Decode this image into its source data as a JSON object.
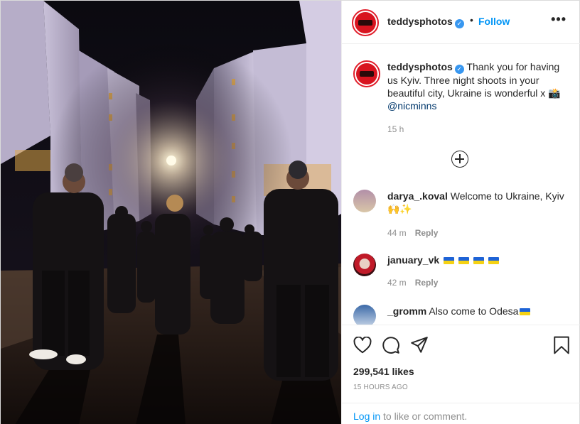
{
  "post": {
    "author": "teddysphotos",
    "follow_label": "Follow",
    "dot": "•",
    "more_label": "•••",
    "caption": {
      "username": "teddysphotos",
      "text": "Thank you for having us Kyiv. Three night shoots in your beautiful city, Ukraine is wonderful x",
      "emoji": "📸",
      "mention": "@nicminns",
      "time": "15 h"
    },
    "comments": [
      {
        "username": "darya_.koval",
        "text": "Welcome to Ukraine, Kyiv",
        "emoji": "🙌✨",
        "time": "44 m",
        "reply": "Reply"
      },
      {
        "username": "january_vk",
        "text": "",
        "flags": 4,
        "time": "42 m",
        "reply": "Reply"
      },
      {
        "username": "_gromm",
        "text": "Also come to Odesa",
        "flags": 1
      }
    ],
    "likes": "299,541 likes",
    "posted": "15 HOURS AGO",
    "login": {
      "link": "Log in",
      "rest": " to like or comment."
    }
  },
  "icons": [
    "heart-icon",
    "comment-icon",
    "share-icon",
    "bookmark-icon",
    "plus-circle-icon",
    "more-icon",
    "verified-icon"
  ],
  "colors": {
    "accent": "#0095f6",
    "verified": "#3897f0",
    "text": "#262626",
    "muted": "#8e8e8e",
    "border": "#efefef"
  }
}
